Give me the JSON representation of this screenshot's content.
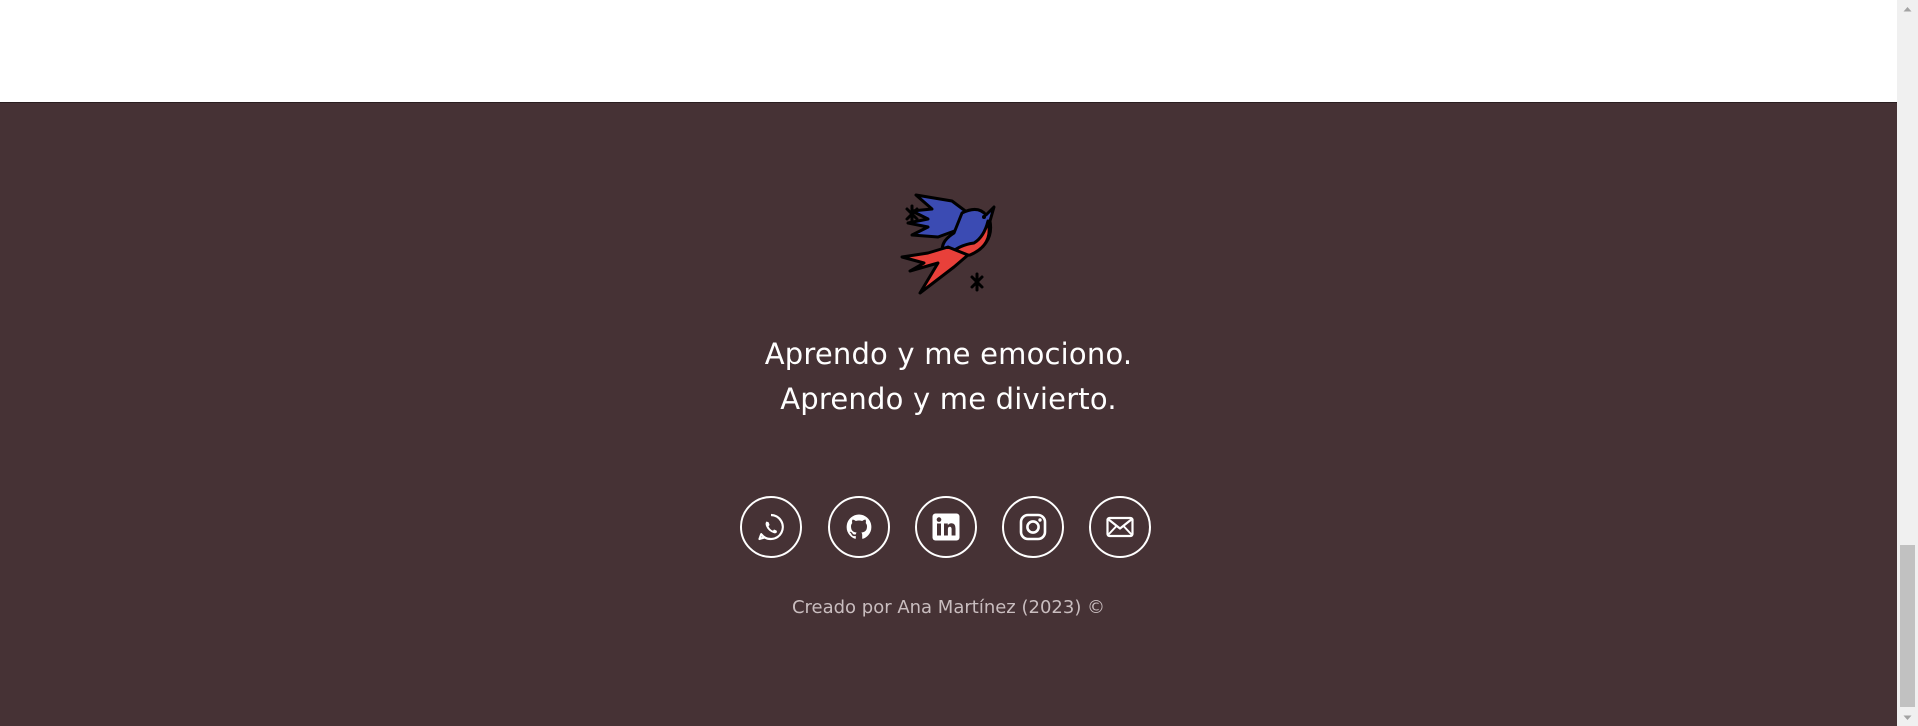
{
  "footer": {
    "background_color": "#463235",
    "text_color": "#ffffff",
    "logo_icon": "swallow-bird-icon",
    "tagline": {
      "line1": "Aprendo y me emociono.",
      "line2": "Aprendo y me divierto."
    },
    "social_links": [
      {
        "icon": "whatsapp-icon"
      },
      {
        "icon": "github-icon"
      },
      {
        "icon": "linkedin-icon"
      },
      {
        "icon": "instagram-icon"
      },
      {
        "icon": "email-icon"
      }
    ],
    "credits": "Creado por Ana Martínez (2023) ©"
  },
  "colors": {
    "bird_blue": "#3b4bb3",
    "bird_red": "#e8403a",
    "scrollbar_track": "#f0f0f0",
    "scrollbar_thumb": "#c1c1c1"
  }
}
